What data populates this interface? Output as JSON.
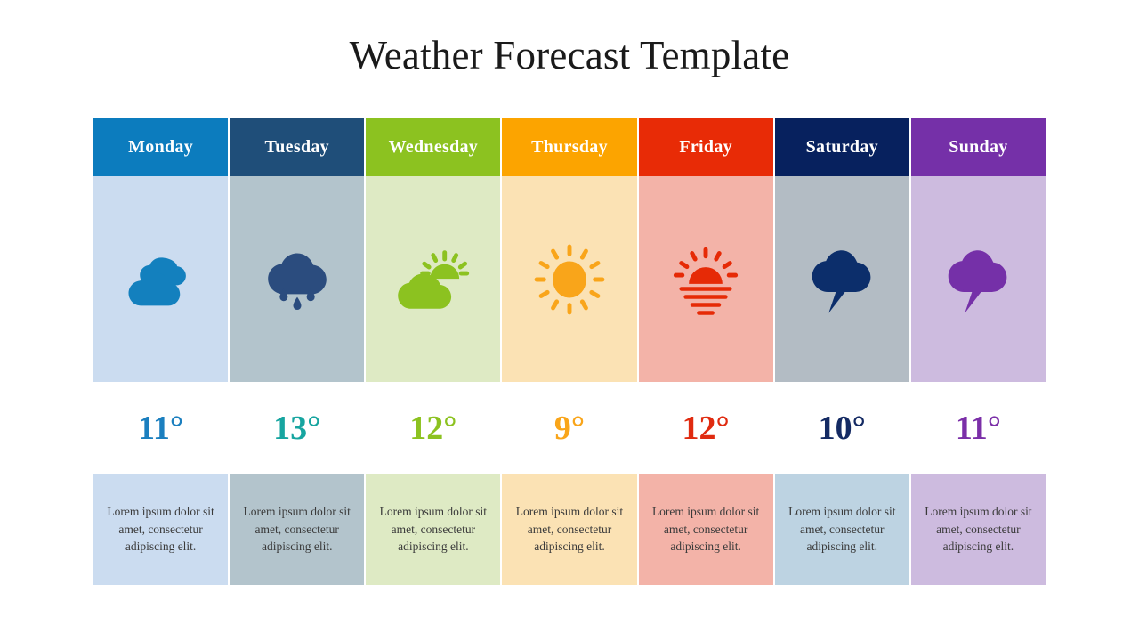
{
  "slide": {
    "title": "Weather Forecast Template",
    "background": "#FFFFFF"
  },
  "columns": [
    {
      "day": "Monday",
      "header_bg": "#0C7CBE",
      "header_text_color": "#FFFFFF",
      "icon_band_bg": "#CBDCF0",
      "icon_name": "cloudy-icon",
      "icon_color": "#1380BE",
      "temperature": "11°",
      "temp_color": "#1B7FBF",
      "desc_band_bg": "#CBDCF0",
      "description": "Lorem ipsum dolor sit amet, consectetur adipiscing elit."
    },
    {
      "day": "Tuesday",
      "header_bg": "#1F4E79",
      "header_text_color": "#FFFFFF",
      "icon_band_bg": "#B3C4CC",
      "icon_name": "rain-cloud-icon",
      "icon_color": "#2B4C7E",
      "temperature": "13°",
      "temp_color": "#17A5A0",
      "desc_band_bg": "#B3C4CC",
      "description": "Lorem ipsum dolor sit amet, consectetur adipiscing elit."
    },
    {
      "day": "Wednesday",
      "header_bg": "#8CC220",
      "header_text_color": "#FFFFFF",
      "icon_band_bg": "#DEEAC4",
      "icon_name": "partly-cloudy-icon",
      "icon_color": "#8CC220",
      "temperature": "12°",
      "temp_color": "#8CC220",
      "desc_band_bg": "#DEEAC4",
      "description": "Lorem ipsum dolor sit amet, consectetur adipiscing elit."
    },
    {
      "day": "Thursday",
      "header_bg": "#FCA400",
      "header_text_color": "#FFFFFF",
      "icon_band_bg": "#FBE2B4",
      "icon_name": "sun-icon",
      "icon_color": "#F9A51A",
      "temperature": "9°",
      "temp_color": "#F9A51A",
      "desc_band_bg": "#FBE2B4",
      "description": "Lorem ipsum dolor sit amet, consectetur adipiscing elit."
    },
    {
      "day": "Friday",
      "header_bg": "#E82B06",
      "header_text_color": "#FFFFFF",
      "icon_band_bg": "#F3B3A8",
      "icon_name": "sunset-icon",
      "icon_color": "#E62A06",
      "temperature": "12°",
      "temp_color": "#E02B10",
      "desc_band_bg": "#F3B3A8",
      "description": "Lorem ipsum dolor sit amet, consectetur adipiscing elit."
    },
    {
      "day": "Saturday",
      "header_bg": "#07215E",
      "header_text_color": "#FFFFFF",
      "icon_band_bg": "#B3BCC4",
      "icon_name": "thunderstorm-icon",
      "icon_color": "#0C2E6B",
      "temperature": "10°",
      "temp_color": "#142A63",
      "desc_band_bg": "#BDD3E2",
      "description": "Lorem ipsum dolor sit amet, consectetur adipiscing elit."
    },
    {
      "day": "Sunday",
      "header_bg": "#7530A8",
      "header_text_color": "#FFFFFF",
      "icon_band_bg": "#CDBBDF",
      "icon_name": "thunderstorm-icon",
      "icon_color": "#7530A8",
      "temperature": "11°",
      "temp_color": "#7B2FA8",
      "desc_band_bg": "#CDBBDF",
      "description": "Lorem ipsum dolor sit amet, consectetur adipiscing elit."
    }
  ]
}
